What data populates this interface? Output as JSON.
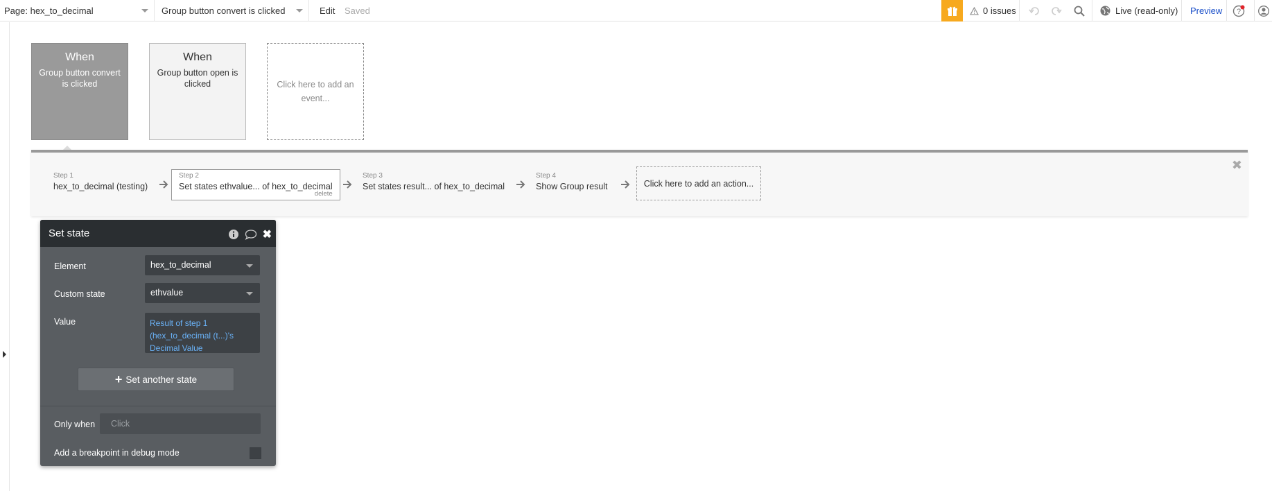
{
  "topbar": {
    "page_label": "Page: hex_to_decimal",
    "workflow_label": "Group button convert is clicked",
    "edit_label": "Edit",
    "saved_label": "Saved",
    "issues_label": "0 issues",
    "live_label": "Live (read-only)",
    "preview_label": "Preview",
    "accent_color": "#f7a91e"
  },
  "events": [
    {
      "when": "When",
      "desc": "Group button convert is clicked"
    },
    {
      "when": "When",
      "desc": "Group button open is clicked"
    },
    {
      "add_label": "Click here to add an event..."
    }
  ],
  "workflow": {
    "steps": [
      {
        "num": "Step 1",
        "label": "hex_to_decimal (testing)"
      },
      {
        "num": "Step 2",
        "label": "Set states ethvalue... of hex_to_decimal",
        "delete_label": "delete"
      },
      {
        "num": "Step 3",
        "label": "Set states result... of hex_to_decimal"
      },
      {
        "num": "Step 4",
        "label": "Show Group result"
      }
    ],
    "add_action_label": "Click here to add an action..."
  },
  "panel": {
    "title": "Set state",
    "element_label": "Element",
    "element_value": "hex_to_decimal",
    "custom_state_label": "Custom state",
    "custom_state_value": "ethvalue",
    "value_label": "Value",
    "value_text": "Result of step 1 (hex_to_decimal (t...)'s Decimal Value",
    "set_another_label": "Set another state",
    "only_when_label": "Only when",
    "only_when_placeholder": "Click",
    "breakpoint_label": "Add a breakpoint in debug mode"
  }
}
